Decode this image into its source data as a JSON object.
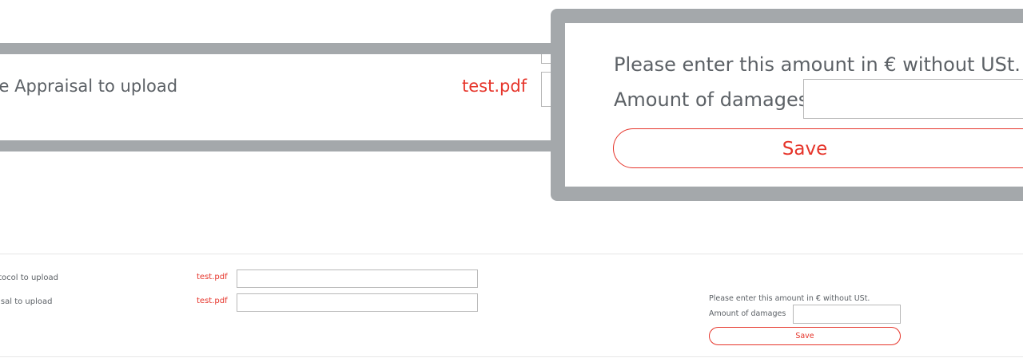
{
  "zoom_callouts": {
    "left": {
      "label": "hicle Appraisal to upload",
      "file": "test.pdf"
    },
    "right": {
      "hint": "Please enter this amount in € without USt.",
      "amount_label": "Amount of damages",
      "amount_value": "",
      "save_label": "Save"
    }
  },
  "form": {
    "rows": [
      {
        "label": "otocol to upload",
        "file": "test.pdf",
        "value": ""
      },
      {
        "label": "aisal to upload",
        "file": "test.pdf",
        "value": ""
      }
    ],
    "hint": "Please enter this amount in € without USt.",
    "amount_label": "Amount of damages",
    "amount_value": "",
    "save_label": "Save"
  },
  "colors": {
    "accent": "#e6352b",
    "text": "#5c6166",
    "callout_frame": "#a4a8ab",
    "border": "#b8b8b8"
  }
}
